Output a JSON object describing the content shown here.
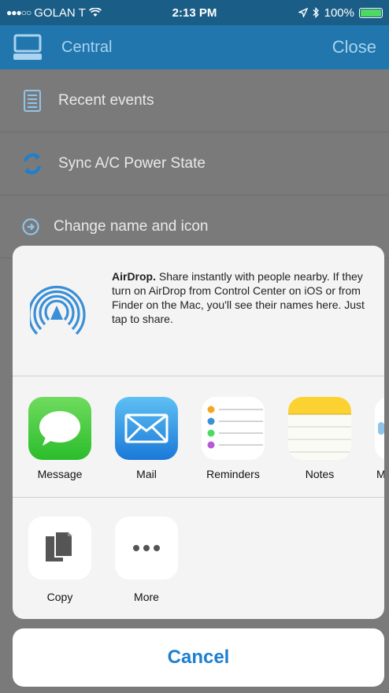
{
  "status_bar": {
    "signal": "●●●○○",
    "carrier": "GOLAN T",
    "time": "2:13 PM",
    "battery": "100%"
  },
  "nav": {
    "title": "Central",
    "close": "Close"
  },
  "list": {
    "items": [
      {
        "label": "Recent events",
        "icon": "list-icon"
      },
      {
        "label": "Sync A/C Power State",
        "icon": "sync-icon"
      },
      {
        "label": "Change name and icon",
        "icon": "arrow-circle-icon"
      }
    ]
  },
  "share": {
    "airdrop_title": "AirDrop.",
    "airdrop_text": " Share instantly with people nearby. If they turn on AirDrop from Control Center on iOS or from Finder on the Mac, you'll see their names here. Just tap to share.",
    "apps": [
      {
        "label": "Message",
        "icon": "message-icon"
      },
      {
        "label": "Mail",
        "icon": "mail-icon"
      },
      {
        "label": "Reminders",
        "icon": "reminders-icon"
      },
      {
        "label": "Notes",
        "icon": "notes-icon"
      },
      {
        "label": "M",
        "icon": "more-app-icon"
      }
    ],
    "actions": [
      {
        "label": "Copy",
        "icon": "copy-icon"
      },
      {
        "label": "More",
        "icon": "ellipsis-icon"
      }
    ]
  },
  "cancel": "Cancel",
  "colors": {
    "nav_bg": "#2076ad",
    "accent": "#1d7fd0",
    "battery": "#4cd964"
  }
}
